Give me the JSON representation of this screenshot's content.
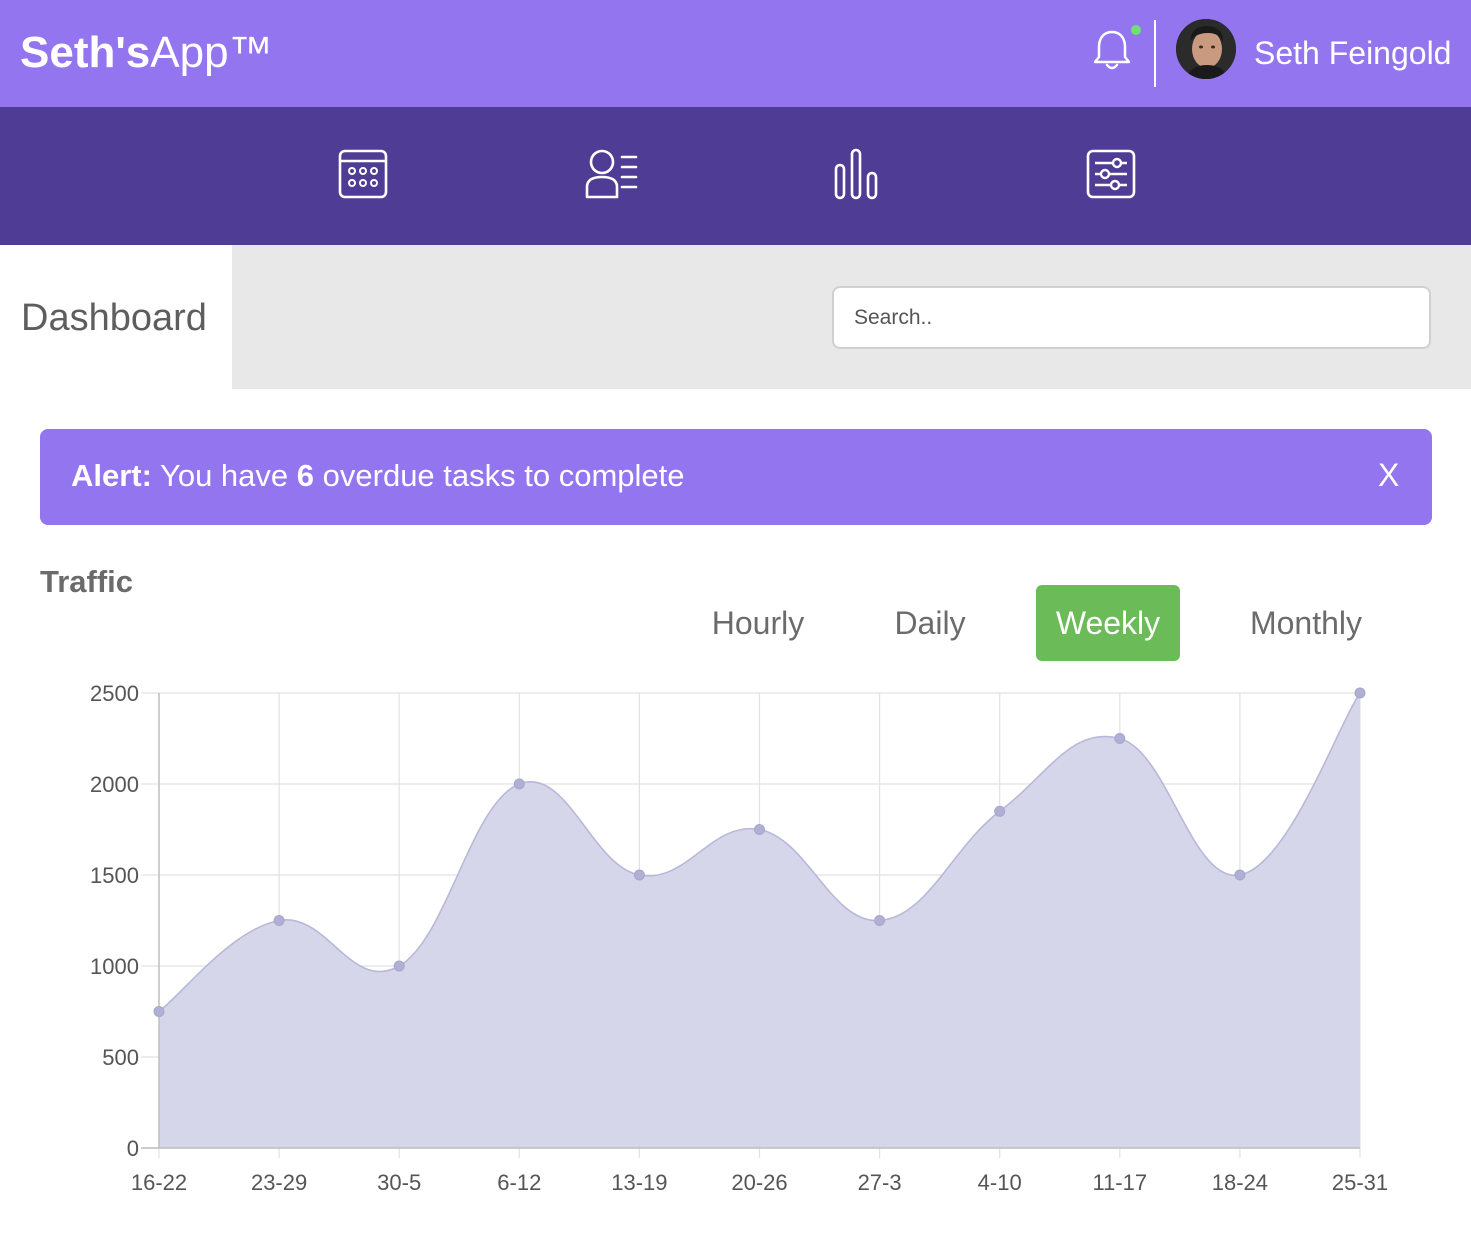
{
  "header": {
    "brand_bold": "Seth's",
    "brand_light": "App™",
    "user_name": "Seth Feingold",
    "notification_dot_color": "#6fe06f",
    "background": "#9376ef"
  },
  "nav": {
    "items": [
      {
        "name": "calendar-icon"
      },
      {
        "name": "members-icon"
      },
      {
        "name": "bar-chart-icon"
      },
      {
        "name": "settings-icon"
      }
    ],
    "background": "#4f3d95"
  },
  "dashboard": {
    "title": "Dashboard",
    "search_placeholder": "Search.."
  },
  "alert": {
    "label": "Alert:",
    "prefix": " You have ",
    "count": "6",
    "suffix": " overdue tasks to complete",
    "close": "X"
  },
  "traffic": {
    "title": "Traffic",
    "tabs": [
      "Hourly",
      "Daily",
      "Weekly",
      "Monthly"
    ],
    "active_tab": "Weekly",
    "active_color": "#6bbb59"
  },
  "chart_data": {
    "type": "area",
    "categories": [
      "16-22",
      "23-29",
      "30-5",
      "6-12",
      "13-19",
      "20-26",
      "27-3",
      "4-10",
      "11-17",
      "18-24",
      "25-31"
    ],
    "values": [
      750,
      1250,
      1000,
      2000,
      1500,
      1750,
      1250,
      1850,
      2250,
      1500,
      2500
    ],
    "yticks": [
      0,
      500,
      1000,
      1500,
      2000,
      2500
    ],
    "ylim": [
      0,
      2500
    ],
    "grid": true,
    "fill_color": "#d4d4ea",
    "line_color": "#b8b8d8",
    "point_color": "#b0b0d4"
  }
}
